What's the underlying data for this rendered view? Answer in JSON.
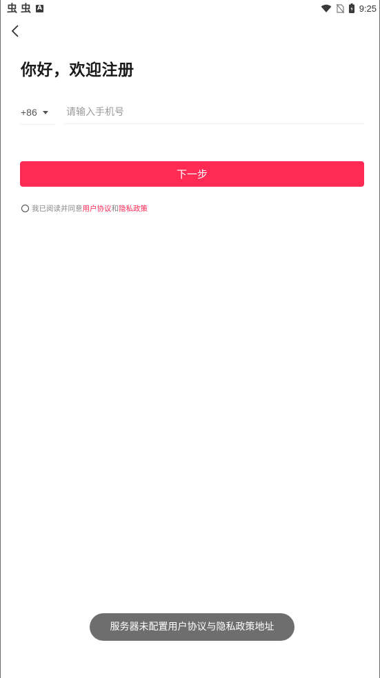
{
  "status_bar": {
    "left_icons": [
      "bug-icon",
      "bug-icon",
      "a-badge-icon"
    ],
    "bug_glyph": "虫",
    "a_badge": "A",
    "time": "9:25"
  },
  "header": {
    "back_icon": "chevron-left-icon",
    "title": "你好，欢迎注册"
  },
  "phone": {
    "country_code": "+86",
    "placeholder": "请输入手机号",
    "value": ""
  },
  "next_button_label": "下一步",
  "agreement": {
    "prefix": "我已阅读并同意",
    "user_agreement": "用户协议",
    "and": "和",
    "privacy_policy": "隐私政策"
  },
  "toast": "服务器未配置用户协议与隐私政策地址",
  "colors": {
    "accent": "#ff2b55",
    "toast_bg": "#6e6e6e"
  }
}
